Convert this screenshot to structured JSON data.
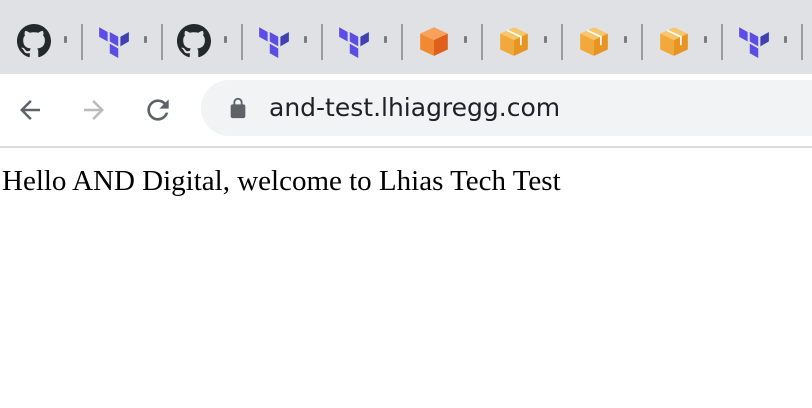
{
  "tabs": [
    {
      "icon": "github-icon"
    },
    {
      "icon": "terraform-icon"
    },
    {
      "icon": "github-icon"
    },
    {
      "icon": "terraform-icon"
    },
    {
      "icon": "terraform-icon"
    },
    {
      "icon": "aws-cube-orange-icon"
    },
    {
      "icon": "aws-box-icon"
    },
    {
      "icon": "aws-box-icon"
    },
    {
      "icon": "aws-box-icon"
    },
    {
      "icon": "terraform-icon"
    }
  ],
  "toolbar": {
    "back_icon": "arrow-left-icon",
    "forward_icon": "arrow-right-icon",
    "reload_icon": "reload-icon"
  },
  "address_bar": {
    "url": "and-test.lhiagregg.com",
    "lock_icon": "lock-icon"
  },
  "page": {
    "body_text": "Hello AND Digital, welcome to Lhias Tech Test"
  },
  "colors": {
    "tabstrip": "#dfe1e5",
    "omnibox": "#f1f3f4",
    "terraform": "#5c4ee5",
    "aws_orange": "#f08a32",
    "aws_box": "#f2a93b"
  }
}
